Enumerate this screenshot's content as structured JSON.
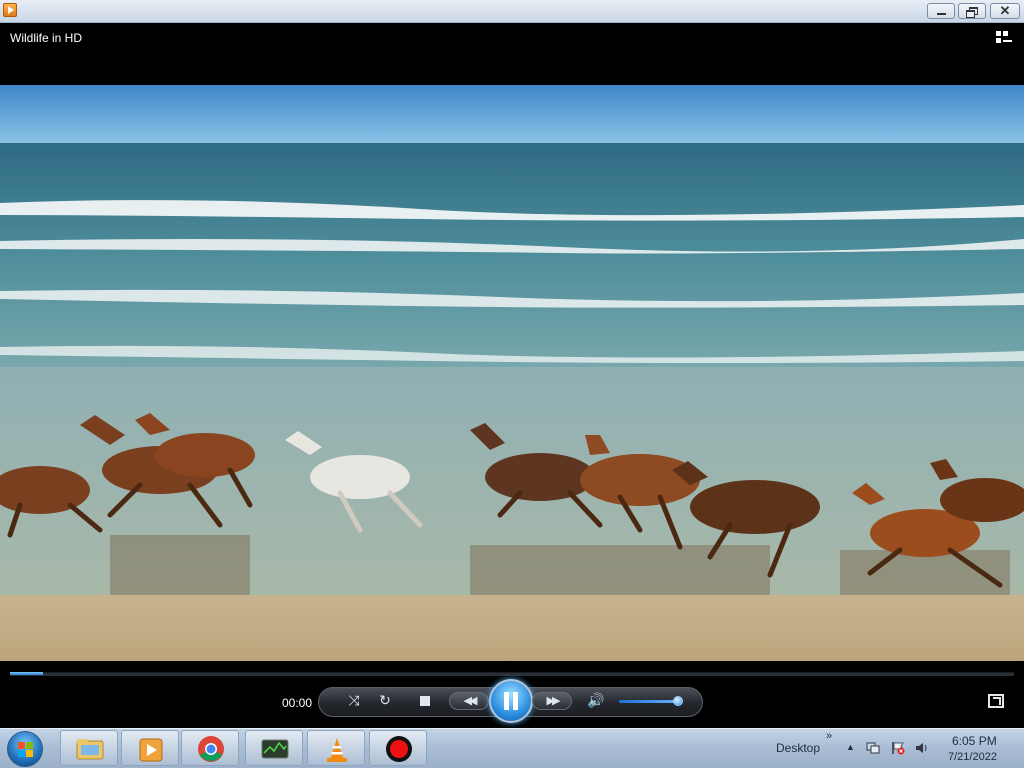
{
  "window": {
    "title": "Wildlife in HD",
    "buttons": {
      "minimize": "minimize",
      "maximize": "restore",
      "close": "✕"
    }
  },
  "player": {
    "time": "00:00",
    "progress_fraction": 0.033,
    "volume_fraction": 0.92,
    "state": "playing",
    "accent": "#2b8ee0"
  },
  "icons": {
    "shuffle": "⤨",
    "repeat": "↻",
    "prev": "◀◀",
    "next": "▶▶",
    "volume": "🔊"
  },
  "taskbar": {
    "desktop_label": "Desktop",
    "chevron": "»",
    "tray_arrow": "▲",
    "clock_time": "6:05 PM",
    "clock_date": "7/21/2022",
    "pinned": [
      "file-explorer",
      "windows-media-player",
      "chrome",
      "task-manager",
      "vlc",
      "recorder"
    ]
  }
}
